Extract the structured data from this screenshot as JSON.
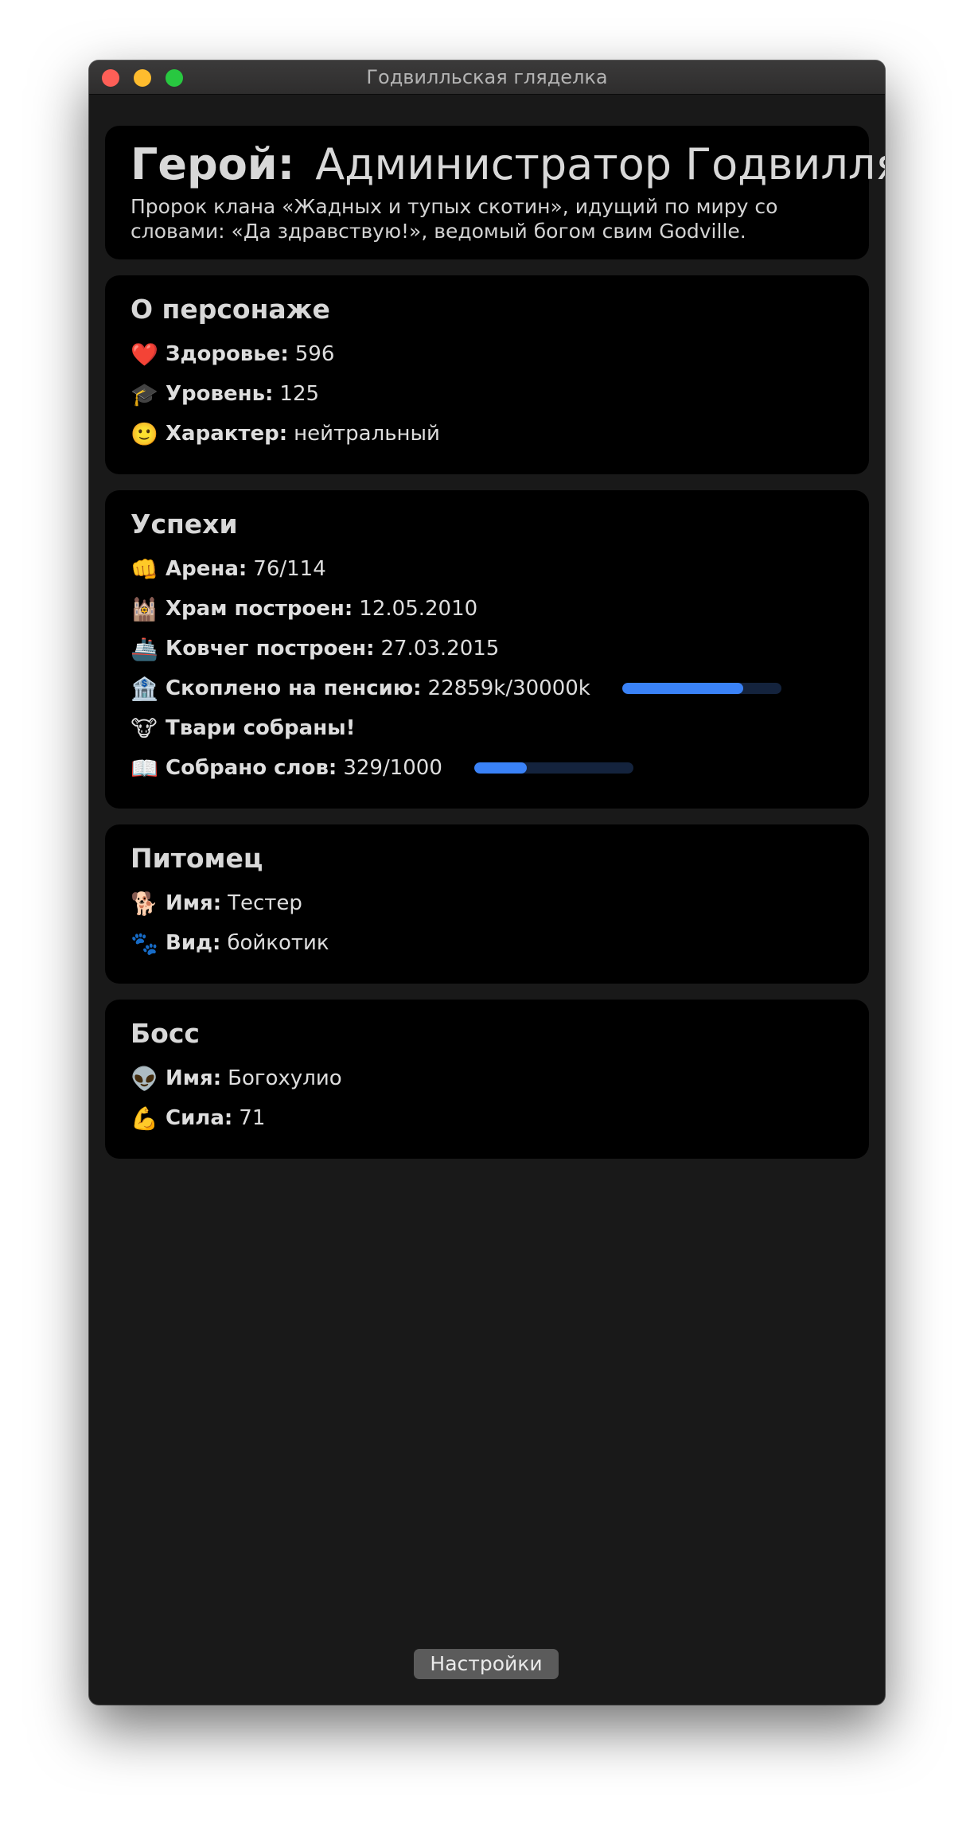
{
  "window": {
    "title": "Годвилльская гляделка"
  },
  "hero": {
    "label": "Герой:",
    "name": "Администратор Годвилля",
    "description": "Пророк клана «Жадных и тупых скотин», идущий по миру со словами: «Да здравствую!», ведомый богом свим Godville."
  },
  "character": {
    "title": "О персонаже",
    "rows": [
      {
        "icon": "❤️",
        "icon_name": "heart-icon",
        "label": "Здоровье:",
        "value": "596"
      },
      {
        "icon": "🎓",
        "icon_name": "graduation-cap-icon",
        "label": "Уровень:",
        "value": "125"
      },
      {
        "icon": "🙂",
        "icon_name": "smile-icon",
        "label": "Характер:",
        "value": "нейтральный"
      }
    ]
  },
  "achievements": {
    "title": "Успехи",
    "rows": [
      {
        "icon": "👊",
        "icon_name": "fist-icon",
        "label": "Арена:",
        "value": "76/114"
      },
      {
        "icon": "🕍",
        "icon_name": "temple-icon",
        "label": "Храм построен:",
        "value": "12.05.2010"
      },
      {
        "icon": "🚢",
        "icon_name": "ship-icon",
        "label": "Ковчег построен:",
        "value": "27.03.2015"
      },
      {
        "icon": "🏦",
        "icon_name": "bank-icon",
        "label": "Скоплено на пенсию:",
        "value": "22859k/30000k",
        "progress": 0.762
      },
      {
        "icon": "🐮",
        "icon_name": "cow-icon",
        "label": "Твари собраны!",
        "value": ""
      },
      {
        "icon": "📖",
        "icon_name": "book-icon",
        "label": "Собрано слов:",
        "value": "329/1000",
        "progress": 0.329
      }
    ]
  },
  "pet": {
    "title": "Питомец",
    "rows": [
      {
        "icon": "🐕",
        "icon_name": "dog-icon",
        "label": "Имя:",
        "value": "Тестер"
      },
      {
        "icon": "🐾",
        "icon_name": "paw-prints-icon",
        "label": "Вид:",
        "value": "бойкотик"
      }
    ]
  },
  "boss": {
    "title": "Босс",
    "rows": [
      {
        "icon": "👽",
        "icon_name": "alien-icon",
        "label": "Имя:",
        "value": "Богохулио"
      },
      {
        "icon": "💪",
        "icon_name": "flexed-biceps-icon",
        "label": "Сила:",
        "value": "71"
      }
    ]
  },
  "settings_button": "Настройки",
  "colors": {
    "window_bg": "#191919",
    "card_bg": "#000000",
    "progress_fill": "#3a82f7",
    "progress_track": "#14233d"
  }
}
